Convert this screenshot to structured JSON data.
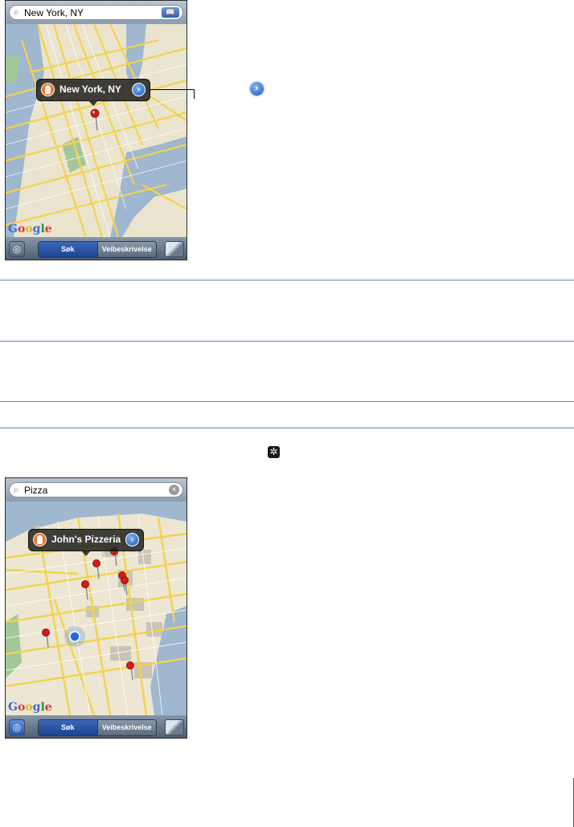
{
  "screen1": {
    "search_text": "New York, NY",
    "callout_title": "New York, NY",
    "tab_search": "Søk",
    "tab_directions": "Veibeskrivelse"
  },
  "screen2": {
    "search_text": "Pizza",
    "callout_title": "John's Pizzeria",
    "tab_search": "Søk",
    "tab_directions": "Veibeskrivelse"
  },
  "map_logo": {
    "letters": [
      "G",
      "o",
      "o",
      "g",
      "l",
      "e"
    ]
  },
  "colors": {
    "accent_rule": "#5b86c4",
    "selected_segment": "#1d4390",
    "pin": "#d21a1a"
  }
}
